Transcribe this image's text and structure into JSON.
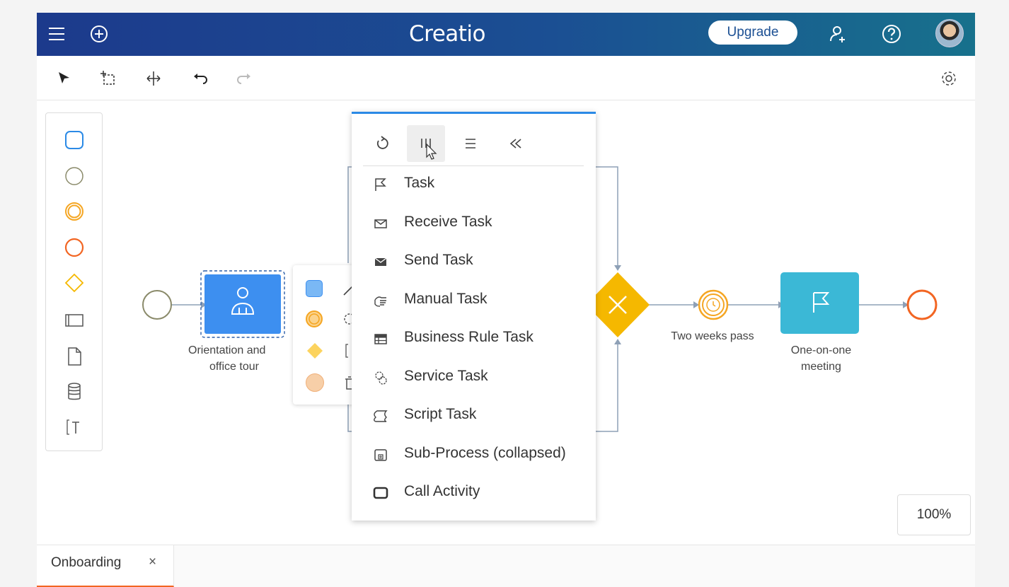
{
  "header": {
    "brand": "Creatio",
    "upgrade_label": "Upgrade"
  },
  "diagram": {
    "orientation_label_line1": "Orientation and",
    "orientation_label_line2": "office tour",
    "timer_label": "Two weeks pass",
    "meeting_label_line1": "One-on-one",
    "meeting_label_line2": "meeting"
  },
  "menu": {
    "items": [
      {
        "label": "Task",
        "icon": "flag-icon"
      },
      {
        "label": "Receive Task",
        "icon": "envelope-outline-icon"
      },
      {
        "label": "Send Task",
        "icon": "envelope-filled-icon"
      },
      {
        "label": "Manual Task",
        "icon": "hand-icon"
      },
      {
        "label": "Business Rule Task",
        "icon": "table-icon"
      },
      {
        "label": "Service Task",
        "icon": "gears-icon"
      },
      {
        "label": "Script Task",
        "icon": "script-icon"
      },
      {
        "label": "Sub-Process (collapsed)",
        "icon": "subprocess-icon"
      },
      {
        "label": "Call Activity",
        "icon": "call-activity-icon"
      }
    ]
  },
  "zoom": "100%",
  "tabs": [
    {
      "label": "Onboarding",
      "close": "×"
    }
  ],
  "colors": {
    "accent": "#2b8ae6",
    "task_blue": "#3d8ff0",
    "gateway_yellow": "#f5b800",
    "meeting_teal": "#3bb8d6",
    "end_red": "#f26522",
    "timer_orange": "#f5a623"
  }
}
